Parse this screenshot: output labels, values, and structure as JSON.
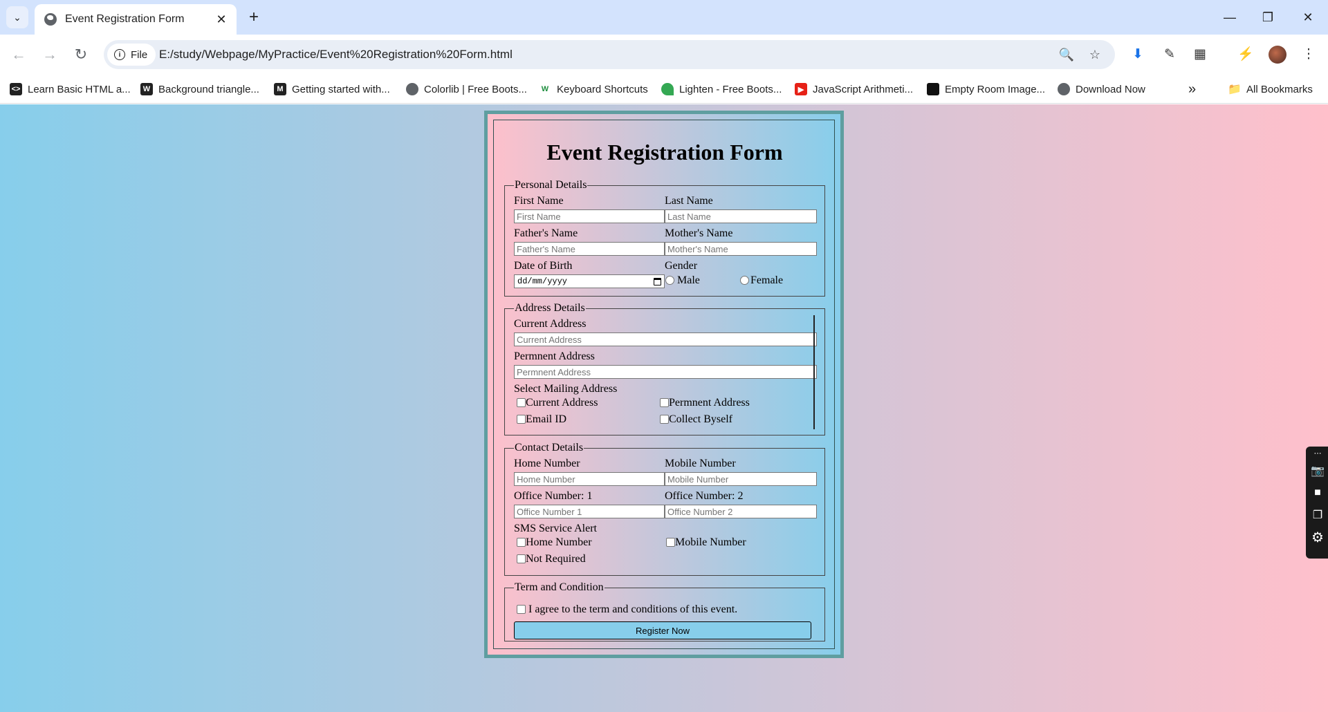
{
  "browser": {
    "tab_title": "Event Registration Form",
    "url": "E:/study/Webpage/MyPractice/Event%20Registration%20Form.html",
    "site_chip": "File",
    "bookmarks": [
      "Learn Basic HTML a...",
      "Background triangle...",
      "Getting started with...",
      "Colorlib | Free Boots...",
      "Keyboard Shortcuts",
      "Lighten - Free Boots...",
      "JavaScript Arithmeti...",
      "Empty Room Image...",
      "Download Now"
    ],
    "all_bookmarks": "All Bookmarks",
    "overflow": "»"
  },
  "form": {
    "title": "Event Registration Form",
    "personal": {
      "legend": "Personal Details",
      "first_name_label": "First Name",
      "first_name_placeholder": "First Name",
      "last_name_label": "Last Name",
      "last_name_placeholder": "Last Name",
      "father_label": "Father's Name",
      "father_placeholder": "Father's Name",
      "mother_label": "Mother's Name",
      "mother_placeholder": "Mother's Name",
      "dob_label": "Date of Birth",
      "dob_value": "dd/mm/yyyy",
      "gender_label": "Gender",
      "male": "Male",
      "female": "Female"
    },
    "address": {
      "legend": "Address Details",
      "current_label": "Current Address",
      "current_placeholder": "Current Address",
      "permanent_label": "Permnent Address",
      "permanent_placeholder": "Permnent Address",
      "mailing_label": "Select Mailing Address",
      "opt_current": "Current Address",
      "opt_permanent": "Permnent Address",
      "opt_email": "Email ID",
      "opt_collect": "Collect Byself"
    },
    "contact": {
      "legend": "Contact Details",
      "home_label": "Home Number",
      "home_placeholder": "Home Number",
      "mobile_label": "Mobile Number",
      "mobile_placeholder": "Mobile Number",
      "office1_label": "Office Number: 1",
      "office1_placeholder": "Office Number 1",
      "office2_label": "Office Number: 2",
      "office2_placeholder": "Office Number 2",
      "sms_label": "SMS Service Alert",
      "sms_home": "Home Number",
      "sms_mobile": "Mobile Number",
      "sms_none": "Not Required"
    },
    "terms": {
      "legend": "Term and Condition",
      "agree": "I agree to the term and conditions of this event.",
      "button": "Register Now"
    }
  },
  "colors": {
    "page_gradient_start": "#87ceeb",
    "page_gradient_end": "#ffc0cb",
    "form_border": "#5f9ea0",
    "button_bg": "#87ceeb"
  }
}
